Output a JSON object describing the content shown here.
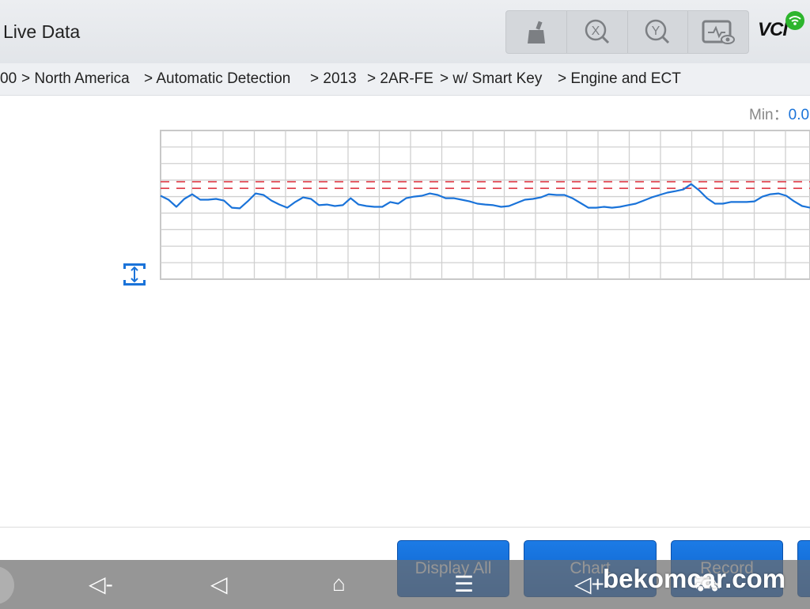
{
  "header": {
    "title": "Live Data",
    "toolbar": [
      {
        "icon": "broom-clear-icon"
      },
      {
        "icon": "x-zoom-icon"
      },
      {
        "icon": "y-zoom-icon"
      },
      {
        "icon": "monitor-eye-icon"
      }
    ],
    "vci_logo": "VCI",
    "vci_status_color": "#2db52d"
  },
  "breadcrumb": [
    "00",
    "> North America",
    "> Automatic Detection",
    "> 2013",
    "> 2AR-FE",
    "> w/ Smart Key",
    "> Engine and ECT"
  ],
  "graph": {
    "min_label": "Min：",
    "min_value": "0.0",
    "line_color": "#1a73d9",
    "threshold_color": "#e0434f",
    "grid_rows": 9,
    "thresholds": [
      5.9,
      5.5
    ],
    "chart_data": {
      "type": "line",
      "ylim": [
        0,
        9
      ],
      "grid": true,
      "values": [
        5.05,
        4.81,
        4.38,
        4.86,
        5.14,
        4.81,
        4.81,
        4.86,
        4.76,
        4.33,
        4.29,
        4.71,
        5.19,
        5.1,
        4.76,
        4.52,
        4.33,
        4.67,
        4.95,
        4.86,
        4.48,
        4.52,
        4.43,
        4.48,
        4.9,
        4.52,
        4.43,
        4.38,
        4.38,
        4.67,
        4.57,
        4.9,
        5.0,
        5.05,
        5.19,
        5.1,
        4.9,
        4.9,
        4.81,
        4.71,
        4.57,
        4.52,
        4.48,
        4.38,
        4.43,
        4.62,
        4.81,
        4.86,
        4.95,
        5.14,
        5.1,
        5.1,
        4.9,
        4.62,
        4.33,
        4.33,
        4.38,
        4.33,
        4.38,
        4.48,
        4.57,
        4.76,
        4.95,
        5.1,
        5.24,
        5.33,
        5.43,
        5.76,
        5.38,
        4.9,
        4.57,
        4.57,
        4.67,
        4.67,
        4.67,
        4.71,
        5.0,
        5.14,
        5.19,
        5.05,
        4.71,
        4.43,
        4.33
      ]
    }
  },
  "buttons": {
    "display_all": "Display All",
    "chart": "Chart",
    "record": "Record"
  },
  "navbar": {
    "vol_down": "volume-down-icon",
    "back": "back-icon",
    "home": "home-icon",
    "menu": "menu-icon",
    "vol_up": "volume-up-icon",
    "car": "car-icon"
  },
  "watermark": "bekomcar.com"
}
